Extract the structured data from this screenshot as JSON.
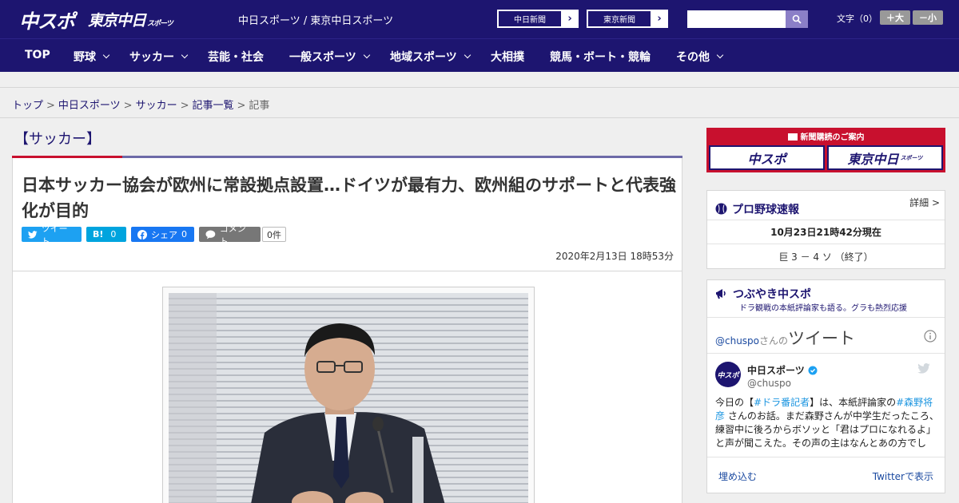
{
  "header": {
    "logo_chuspo": "中スポ",
    "logo_tokyo": "東京中日",
    "logo_tokyo_sub": "スポーツ",
    "site_names": "中日スポーツ / 東京中日スポーツ",
    "paper_buttons": [
      "中日新聞",
      "東京新聞"
    ],
    "search_placeholder": "",
    "font_label": "文字（0）",
    "font_plus": "＋大",
    "font_minus": "－小"
  },
  "nav": {
    "items": [
      {
        "label": "TOP",
        "dropdown": false
      },
      {
        "label": "野球",
        "dropdown": true
      },
      {
        "label": "サッカー",
        "dropdown": true
      },
      {
        "label": "芸能・社会",
        "dropdown": false
      },
      {
        "label": "一般スポーツ",
        "dropdown": true
      },
      {
        "label": "地域スポーツ",
        "dropdown": true
      },
      {
        "label": "大相撲",
        "dropdown": false
      },
      {
        "label": "競馬・ボート・競輪",
        "dropdown": false
      },
      {
        "label": "その他",
        "dropdown": true
      }
    ]
  },
  "breadcrumb": {
    "items": [
      "トップ",
      "中日スポーツ",
      "サッカー",
      "記事一覧"
    ],
    "current": "記事",
    "separator": ">"
  },
  "article": {
    "category": "【サッカー】",
    "headline": "日本サッカー協会が欧州に常設拠点設置…ドイツが最有力、欧州組のサポートと代表強化が目的",
    "share": {
      "tweet": "ツイート",
      "hatena": "B!",
      "hatena_count": "0",
      "facebook": "シェア",
      "facebook_count": "0",
      "comment": "コメント",
      "comment_count": "0件"
    },
    "date": "2020年2月13日 18時53分"
  },
  "sidebar": {
    "subscribe": {
      "title": "新聞購読のご案内",
      "logo1": "中スポ",
      "logo2": "東京中日",
      "logo2_sub": "スポーツ"
    },
    "yakyu": {
      "title": "プロ野球速報",
      "detail": "詳細 >",
      "time": "10月23日21時42分現在",
      "score": "巨 3 － 4 ソ （終了）"
    },
    "tsubuyaki": {
      "title": "つぶやき中スポ",
      "subtitle": "ドラ観戦の本紙評論家も語る。グラも熱烈応援",
      "tweets_by_handle": "@chuspo",
      "tweets_by_suffix": "さんの",
      "tweets_by_label": "ツイート",
      "account_name": "中日スポーツ",
      "account_handle": "@chuspo",
      "tweet_1": "今日の【",
      "tweet_tag1": "#ドラ番記者",
      "tweet_2": "】は、本紙評論家の",
      "tweet_tag2": "#森野将彦",
      "tweet_3": " さんのお話。まだ森野さんが中学生だったころ、練習中に後ろからボソッと「君はプロになれるよ」と声が聞こえた。その声の主はなんとあの方でし",
      "embed": "埋め込む",
      "view_on_twitter": "Twitterで表示"
    }
  }
}
